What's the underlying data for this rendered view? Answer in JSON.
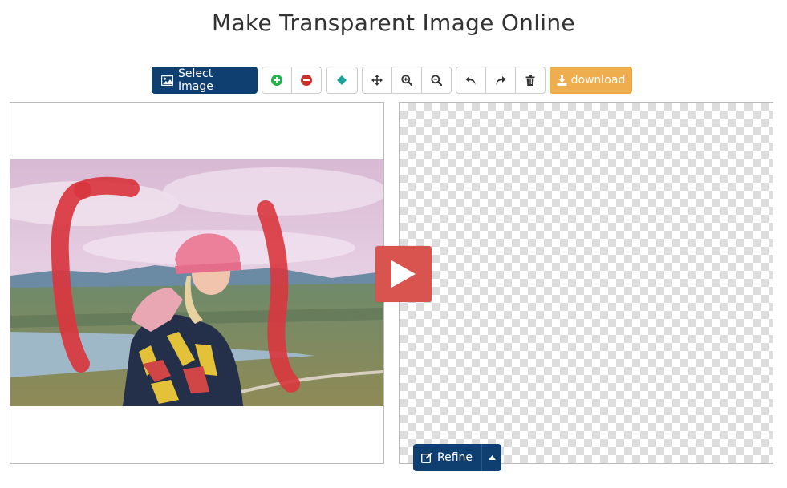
{
  "page": {
    "title": "Make Transparent Image Online"
  },
  "toolbar": {
    "select_image_label": "Select Image",
    "download_label": "download",
    "icons": {
      "select_image": "image-icon",
      "add_mark": "plus-circle-icon",
      "remove_mark": "minus-circle-icon",
      "eraser": "eraser-icon",
      "move": "move-icon",
      "zoom_in": "zoom-in-icon",
      "zoom_out": "zoom-out-icon",
      "undo": "undo-icon",
      "redo": "redo-icon",
      "delete": "trash-icon",
      "download": "download-icon"
    }
  },
  "canvas": {
    "play_icon": "play-icon",
    "checkerboard": "transparent-background"
  },
  "refine": {
    "label": "Refine",
    "icon": "edit-icon",
    "caret_icon": "caret-up-icon"
  },
  "colors": {
    "primary": "#0e3f70",
    "download": "#f0ad4e",
    "play": "#d9534f",
    "add": "#22b14c",
    "remove": "#c9302c",
    "eraser": "#1aa39a",
    "mark": "#d9363e"
  }
}
